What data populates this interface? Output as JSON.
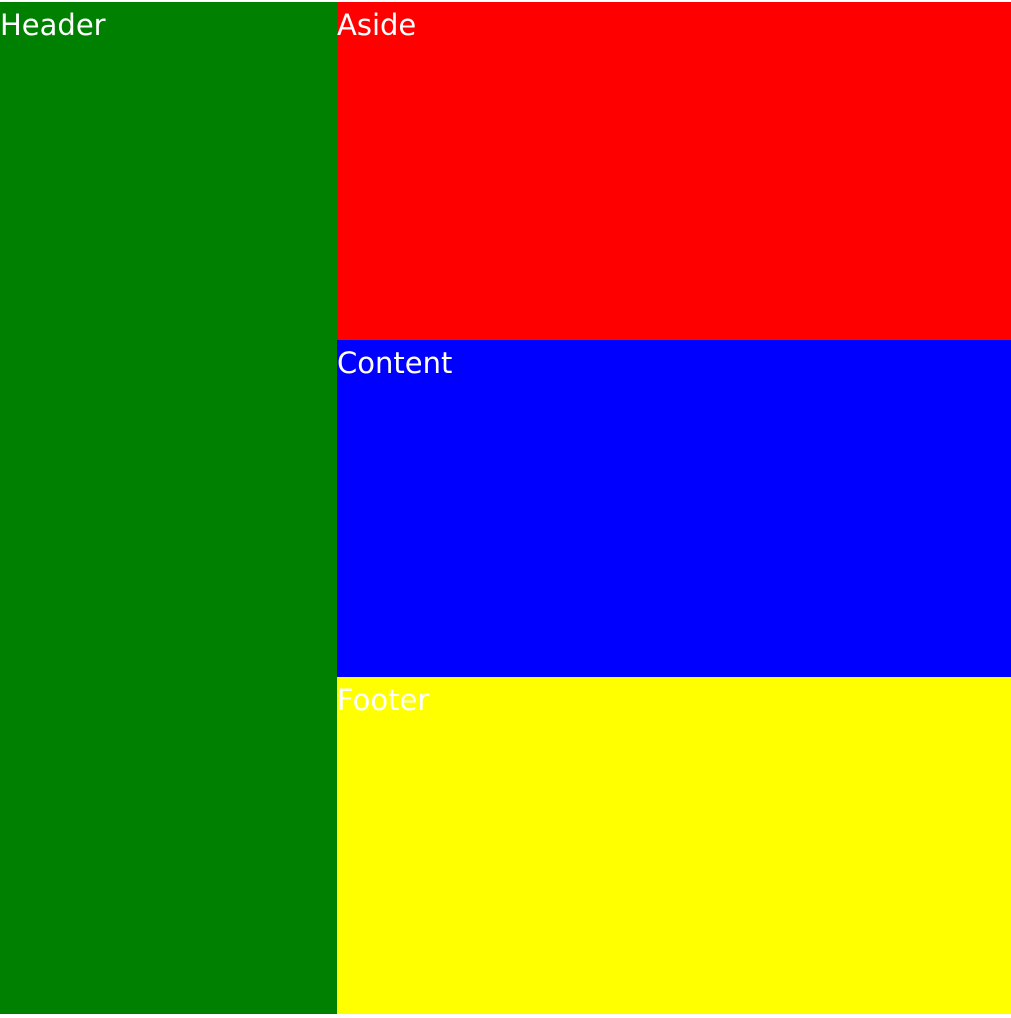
{
  "regions": {
    "header": {
      "label": "Header",
      "color": "#008000"
    },
    "aside": {
      "label": "Aside",
      "color": "#ff0000"
    },
    "content": {
      "label": "Content",
      "color": "#0000ff"
    },
    "footer": {
      "label": "Footer",
      "color": "#ffff00"
    }
  }
}
